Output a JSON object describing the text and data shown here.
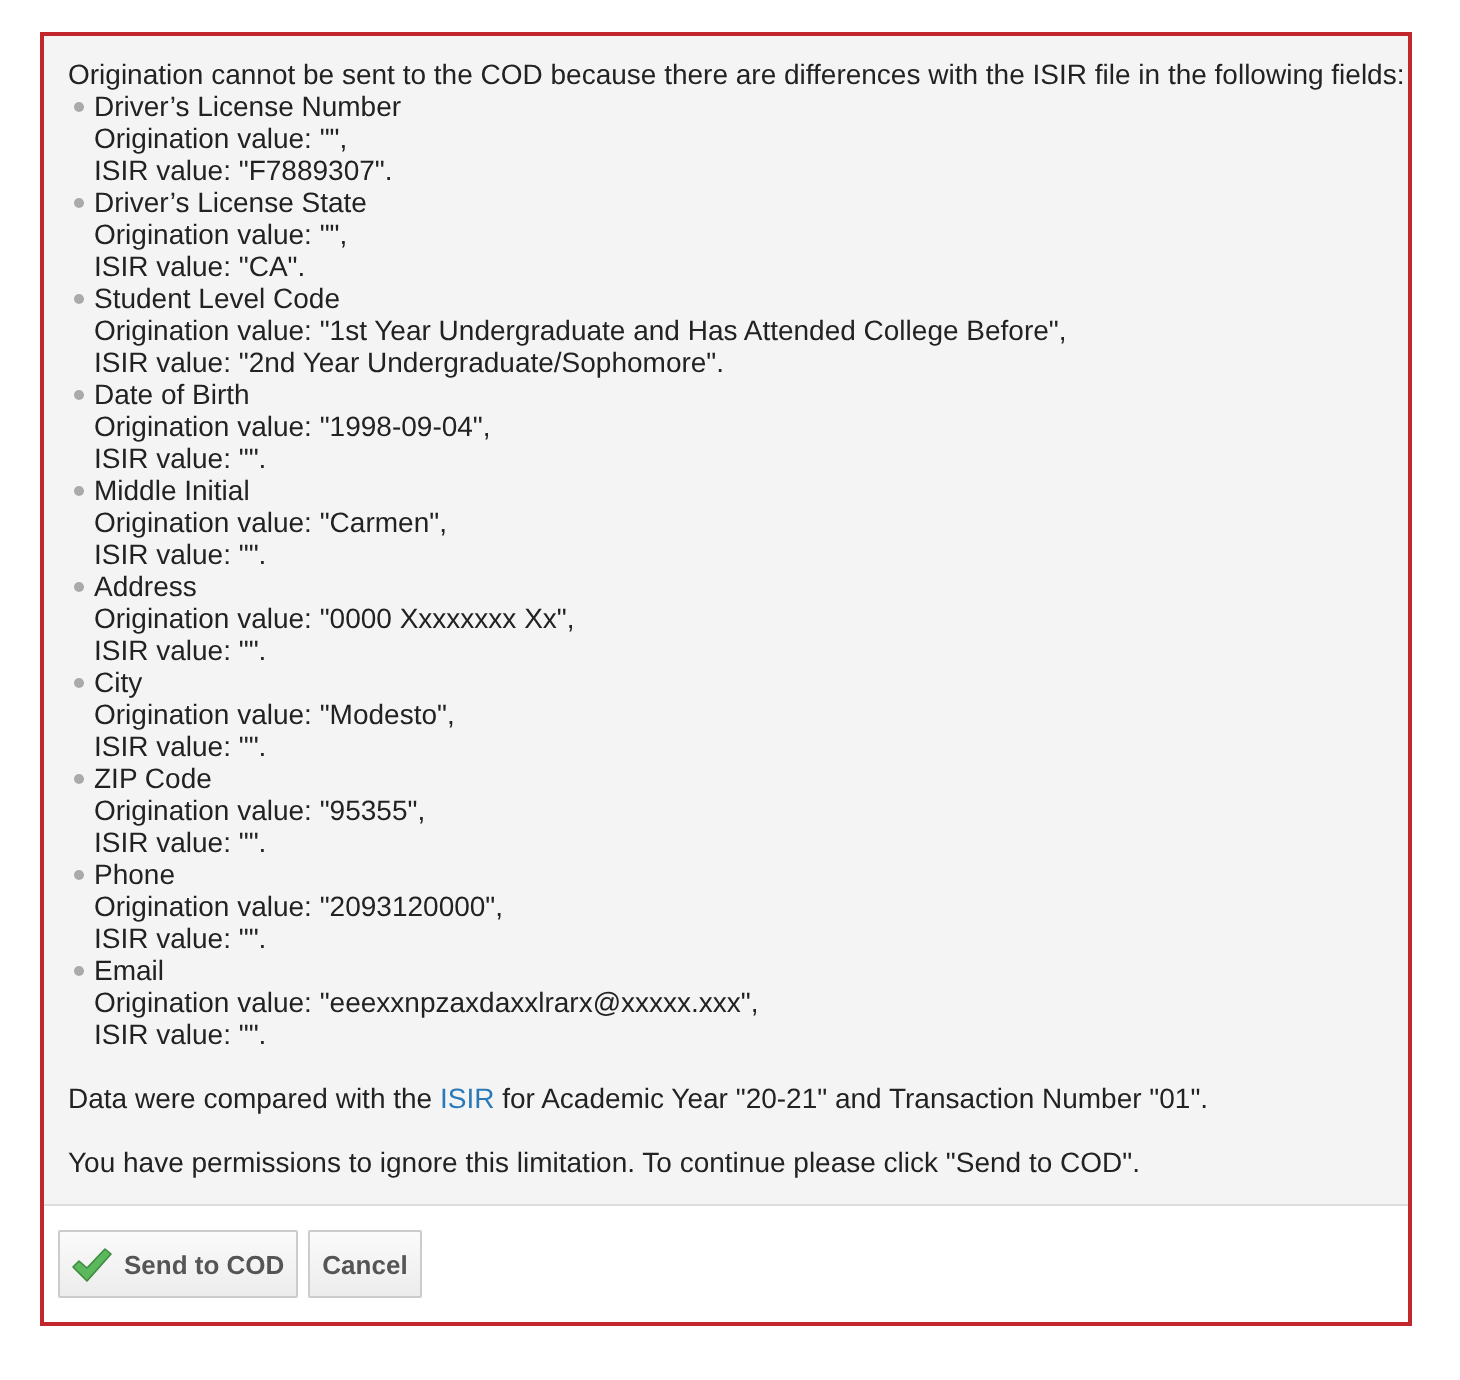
{
  "message": {
    "intro": "Origination cannot be sent to the COD because there are differences with the ISIR file in the following fields:",
    "fields": [
      {
        "label": "Driver’s License Number",
        "origination": "Origination value: \"\",",
        "isir": "ISIR value: \"F7889307\"."
      },
      {
        "label": "Driver’s License State",
        "origination": "Origination value: \"\",",
        "isir": "ISIR value: \"CA\"."
      },
      {
        "label": "Student Level Code",
        "origination": "Origination value: \"1st Year Undergraduate and Has Attended College Before\",",
        "isir": "ISIR value: \"2nd Year Undergraduate/Sophomore\"."
      },
      {
        "label": "Date of Birth",
        "origination": "Origination value: \"1998-09-04\",",
        "isir": "ISIR value: \"\"."
      },
      {
        "label": "Middle Initial",
        "origination": "Origination value: \"Carmen\",",
        "isir": "ISIR value: \"\"."
      },
      {
        "label": "Address",
        "origination": "Origination value: \"0000 Xxxxxxxx Xx\",",
        "isir": "ISIR value: \"\"."
      },
      {
        "label": "City",
        "origination": "Origination value: \"Modesto\",",
        "isir": "ISIR value: \"\"."
      },
      {
        "label": "ZIP Code",
        "origination": "Origination value: \"95355\",",
        "isir": "ISIR value: \"\"."
      },
      {
        "label": "Phone",
        "origination": "Origination value: \"2093120000\",",
        "isir": "ISIR value: \"\"."
      },
      {
        "label": "Email",
        "origination": "Origination value: \"eeexxnpzaxdaxxlrarx@xxxxx.xxx\",",
        "isir": "ISIR value: \"\"."
      }
    ],
    "comparison": {
      "before": "Data were compared with the ",
      "link": "ISIR",
      "after": " for Academic Year \"20-21\" and Transaction Number \"01\"."
    },
    "permission": "You have permissions to ignore this limitation. To continue please click \"Send to COD\"."
  },
  "buttons": [
    {
      "kind": "confirm",
      "label": "Send to COD"
    },
    {
      "kind": "cancel",
      "label": "Cancel"
    }
  ]
}
